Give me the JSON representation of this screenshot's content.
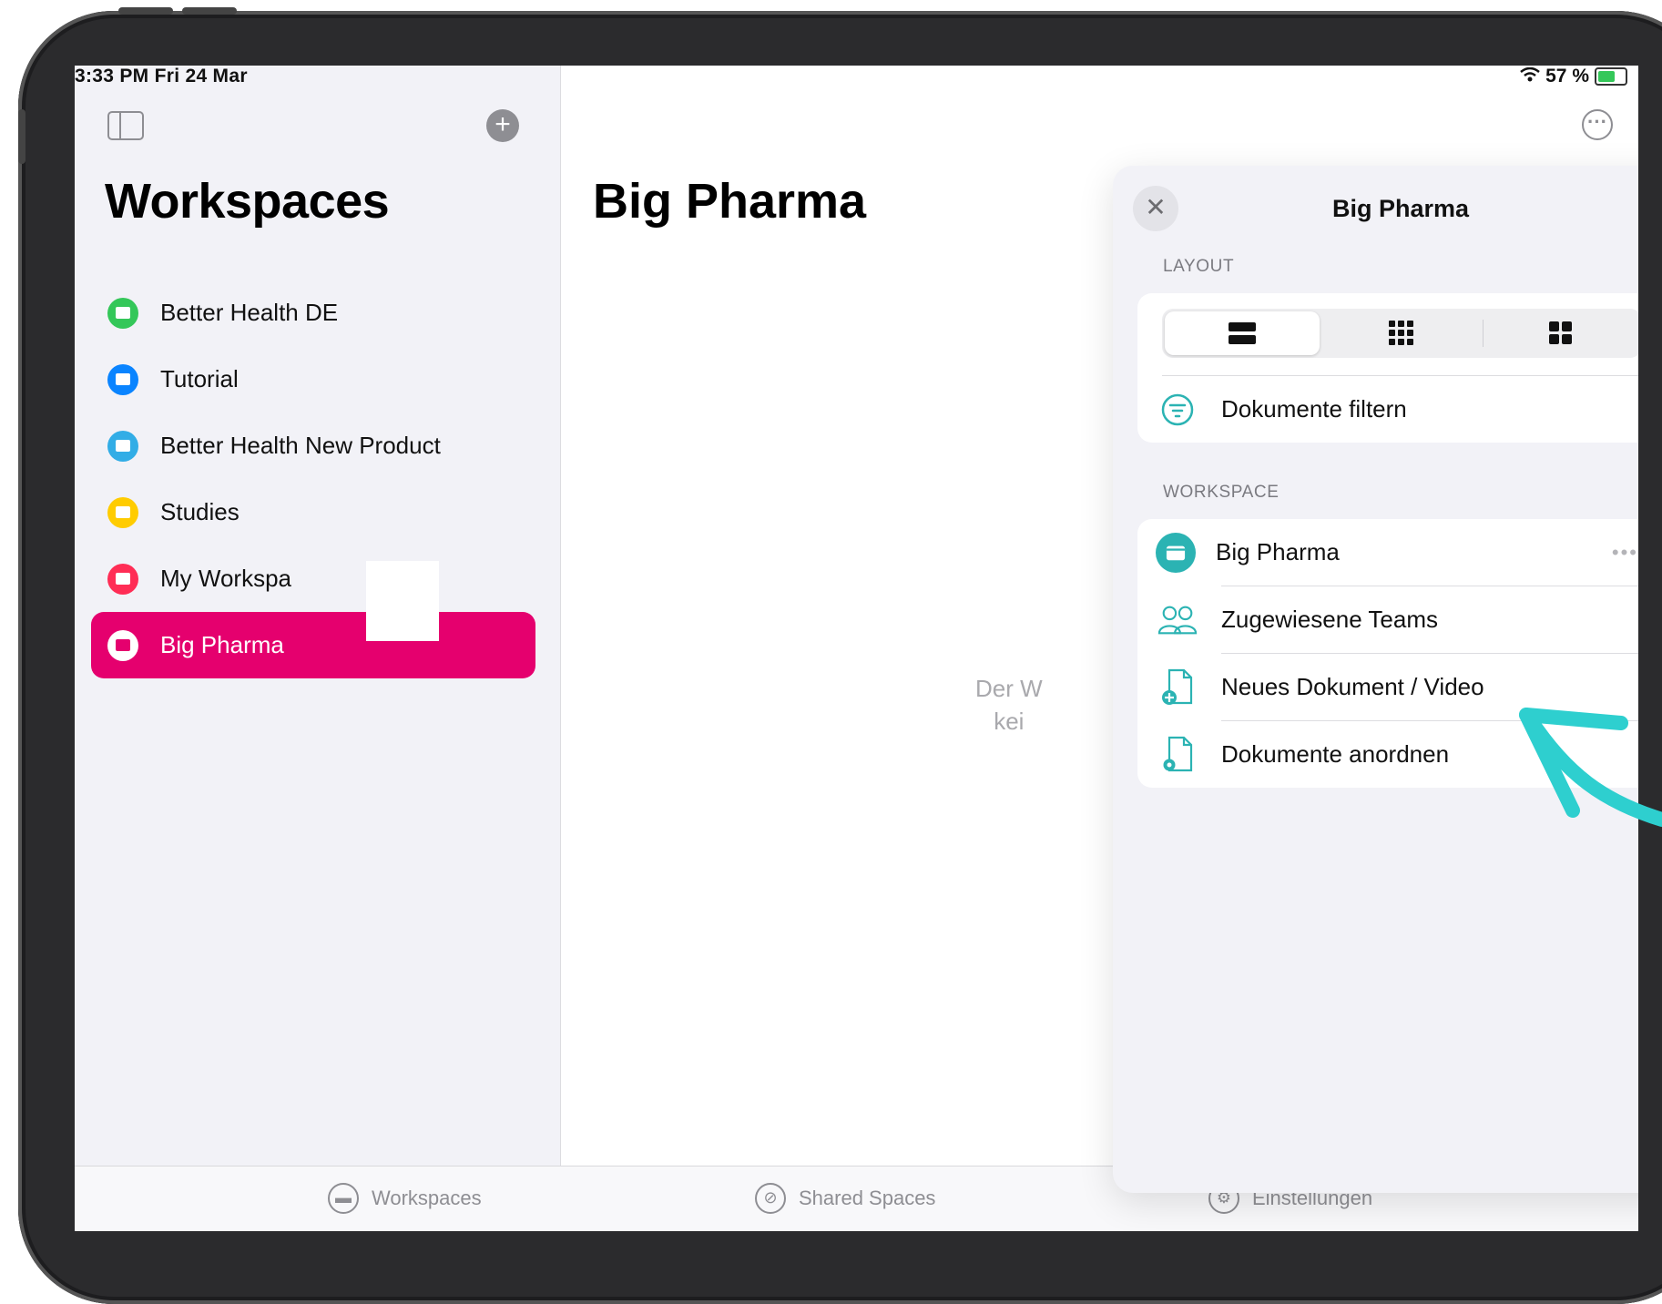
{
  "status_bar": {
    "time_date": "3:33 PM   Fri 24 Mar",
    "battery": "57 %"
  },
  "sidebar": {
    "title": "Workspaces",
    "items": [
      {
        "label": "Better Health DE",
        "color": "#34c759"
      },
      {
        "label": "Tutorial",
        "color": "#0a84ff"
      },
      {
        "label": "Better Health New Product",
        "color": "#32ade6"
      },
      {
        "label": "Studies",
        "color": "#ffcc00"
      },
      {
        "label": "My Workspa",
        "color": "#ff2d55"
      },
      {
        "label": "Big Pharma",
        "color": "#e5006e"
      }
    ]
  },
  "main": {
    "title": "Big Pharma",
    "empty_line1": "Der W",
    "empty_line2": "kei"
  },
  "popover": {
    "title": "Big Pharma",
    "layout_header": "LAYOUT",
    "filter_label": "Dokumente filtern",
    "workspace_header": "WORKSPACE",
    "workspace_name": "Big Pharma",
    "teams_label": "Zugewiesene Teams",
    "new_doc_label": "Neues Dokument / Video",
    "arrange_label": "Dokumente anordnen",
    "accent": "#2bb3b3"
  },
  "tabbar": {
    "workspaces": "Workspaces",
    "shared": "Shared Spaces",
    "settings": "Einstellungen"
  },
  "annotation_color": "#2ecfcf"
}
